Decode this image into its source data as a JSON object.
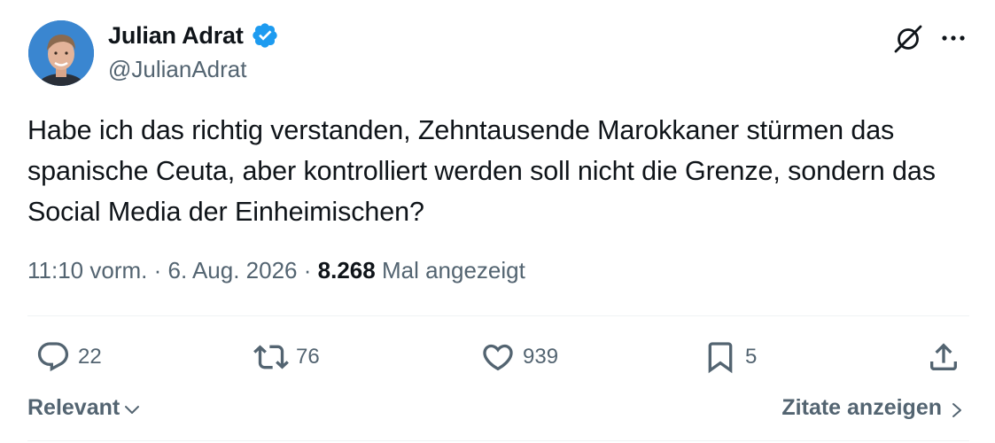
{
  "author": {
    "display_name": "Julian Adrat",
    "handle": "@JulianAdrat",
    "verified": true,
    "avatar_icon": "profile-photo"
  },
  "header_icons": {
    "grok": "grok-icon",
    "more": "more-horizontal-icon"
  },
  "tweet": {
    "text": "Habe ich das richtig verstanden, Zehntausende Marokkaner stürmen das spanische Ceuta, aber kontrolliert werden soll nicht die Grenze, sondern das Social Media der Einheimischen?",
    "time": "11:10 vorm.",
    "separator": "·",
    "date": "6. Aug. 2026",
    "views_count": "8.268",
    "views_label": "Mal angezeigt"
  },
  "actions": {
    "reply": {
      "icon": "reply-icon",
      "count": "22"
    },
    "retweet": {
      "icon": "retweet-icon",
      "count": "76"
    },
    "like": {
      "icon": "heart-icon",
      "count": "939"
    },
    "bookmark": {
      "icon": "bookmark-icon",
      "count": "5"
    },
    "share": {
      "icon": "share-icon"
    }
  },
  "footer": {
    "sort_label": "Relevant",
    "quotes_label": "Zitate anzeigen"
  },
  "colors": {
    "text_primary": "#0f1419",
    "text_secondary": "#536471",
    "verified_blue": "#1d9bf0",
    "divider": "#eff3f4"
  }
}
